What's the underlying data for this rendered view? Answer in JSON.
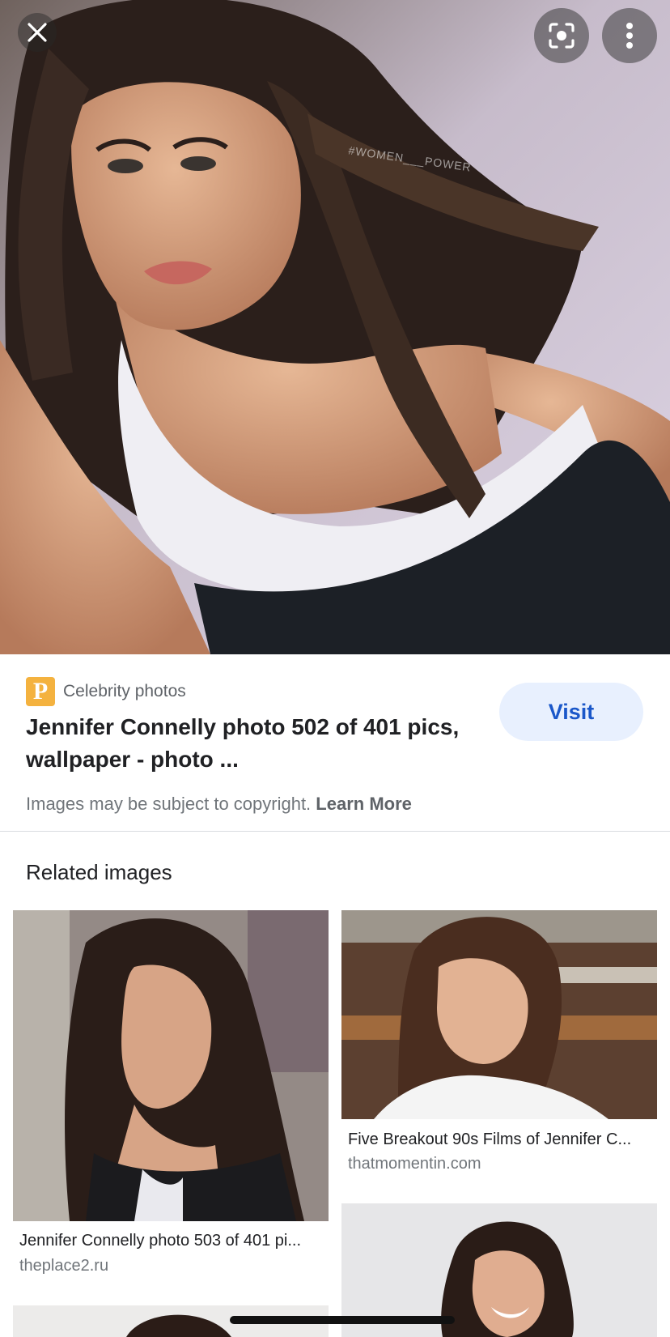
{
  "viewer": {
    "actions": [
      {
        "name": "close",
        "icon": "close-icon"
      },
      {
        "name": "google-lens",
        "icon": "lens-icon"
      },
      {
        "name": "more-options",
        "icon": "more-vert-icon"
      }
    ],
    "watermark": "#WOMEN___POWER"
  },
  "result": {
    "source_name": "Celebrity photos",
    "favicon_letter": "P",
    "favicon_color": "#f4b23f",
    "title": "Jennifer Connelly photo 502 of 401 pics, wallpaper - photo ...",
    "visit_label": "Visit",
    "copyright_text": "Images may be subject to copyright.",
    "learn_more_label": "Learn More"
  },
  "related": {
    "heading": "Related images",
    "items": [
      {
        "caption": "Jennifer Connelly photo 503 of 401 pi...",
        "domain": "theplace2.ru"
      },
      {
        "caption": "Five Breakout 90s Films of Jennifer C...",
        "domain": "thatmomentin.com"
      }
    ]
  },
  "colors": {
    "accent": "#1a57c9",
    "visit_bg": "#e8f0fe",
    "text_primary": "#202124",
    "text_secondary": "#70757a"
  }
}
